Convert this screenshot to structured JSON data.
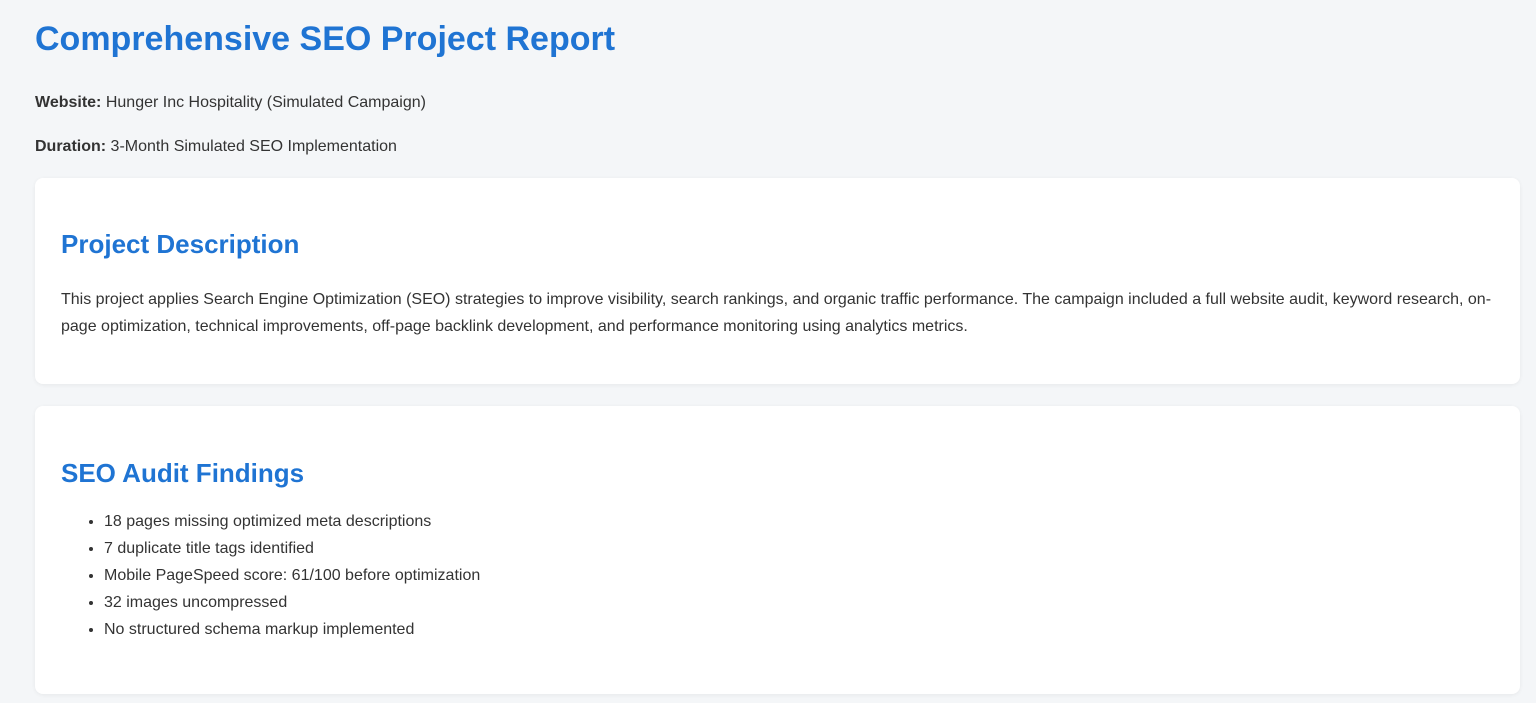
{
  "header": {
    "title": "Comprehensive SEO Project Report",
    "website_label": "Website:",
    "website_value": " Hunger Inc Hospitality (Simulated Campaign)",
    "duration_label": "Duration:",
    "duration_value": " 3-Month Simulated SEO Implementation"
  },
  "project_description": {
    "heading": "Project Description",
    "text": "This project applies Search Engine Optimization (SEO) strategies to improve visibility, search rankings, and organic traffic performance. The campaign included a full website audit, keyword research, on-page optimization, technical improvements, off-page backlink development, and performance monitoring using analytics metrics."
  },
  "audit_findings": {
    "heading": "SEO Audit Findings",
    "items": [
      "18 pages missing optimized meta descriptions",
      "7 duplicate title tags identified",
      "Mobile PageSpeed score: 61/100 before optimization",
      "32 images uncompressed",
      "No structured schema markup implemented"
    ]
  },
  "colors": {
    "accent": "#1f74d3",
    "background": "#f4f6f8",
    "card": "#ffffff",
    "text": "#333333"
  }
}
